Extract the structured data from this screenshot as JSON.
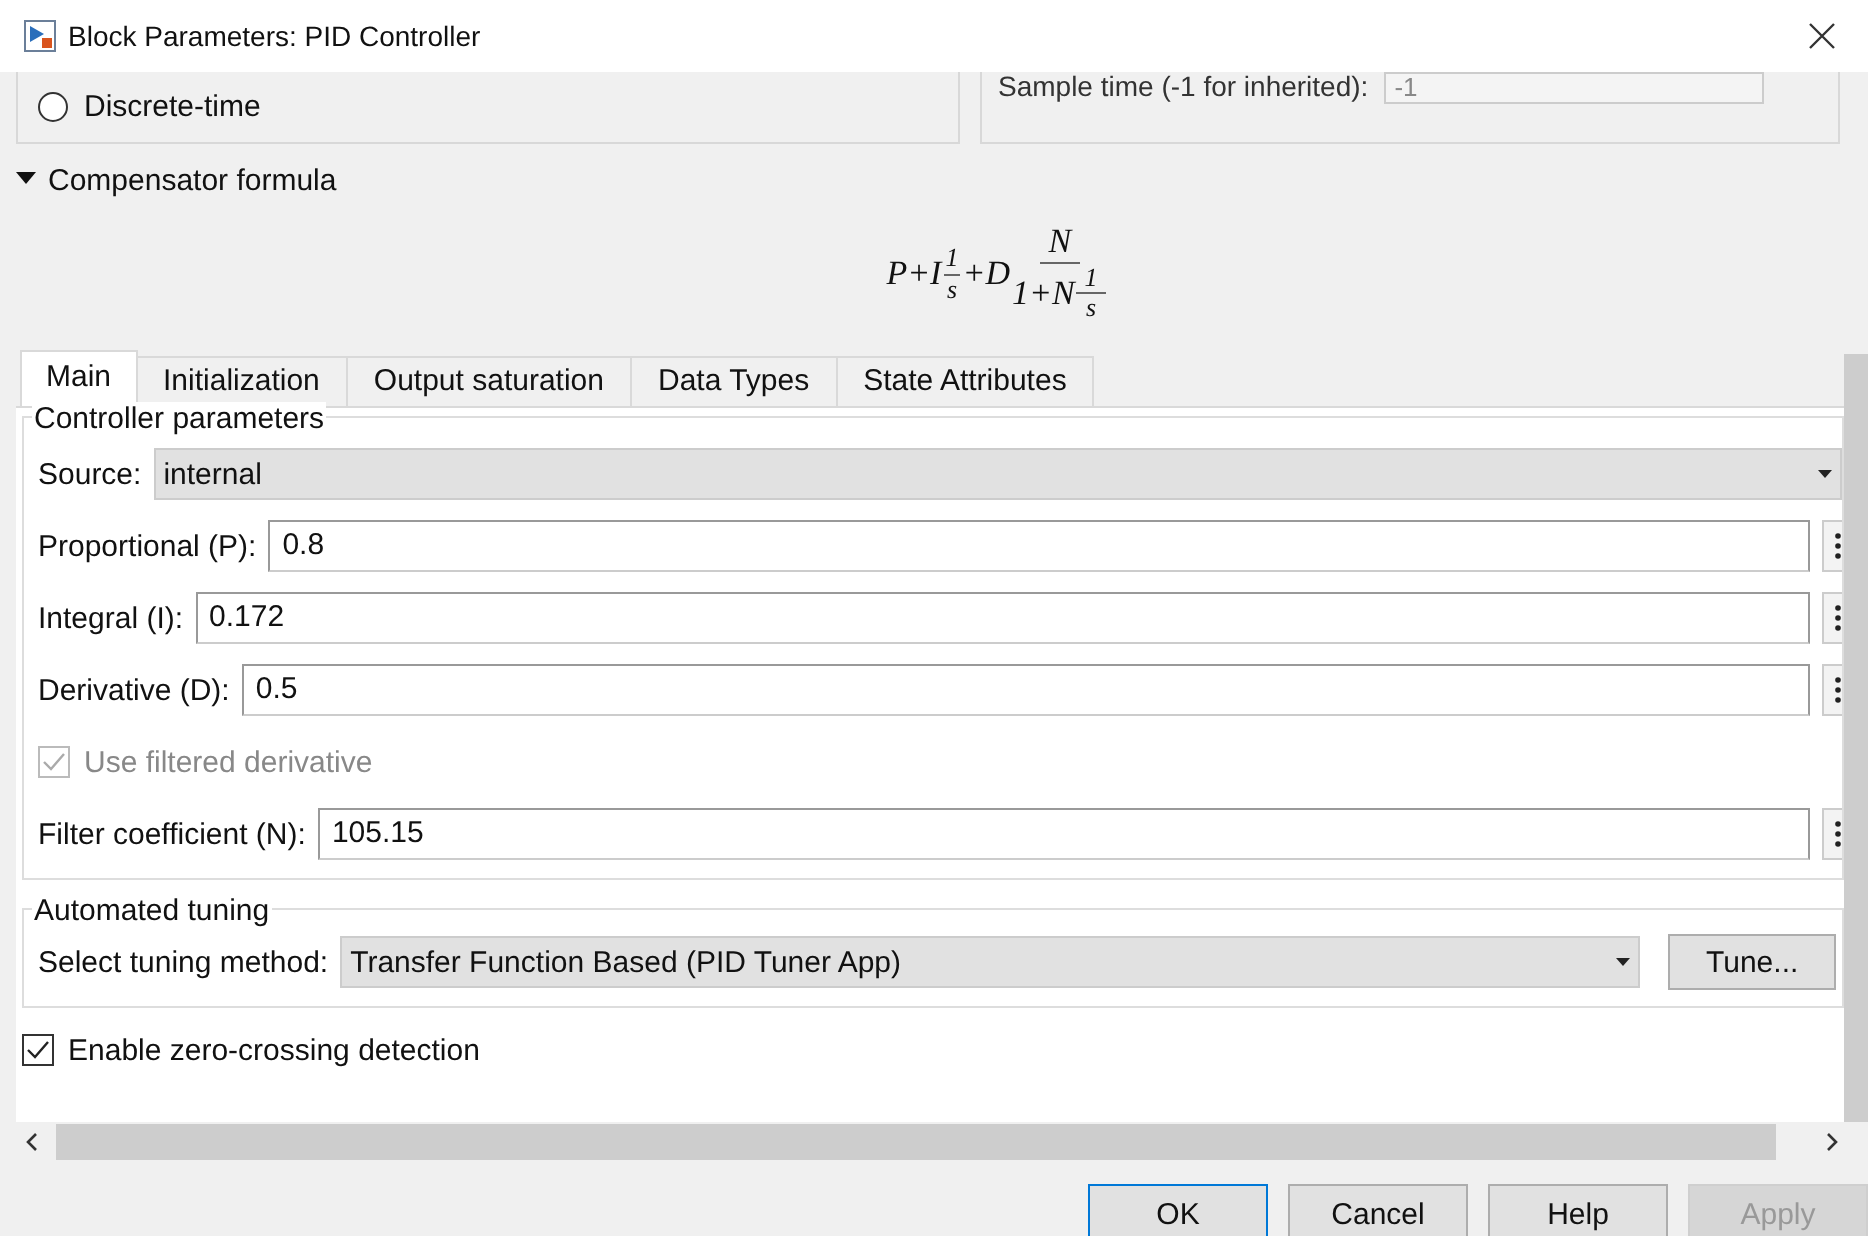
{
  "window": {
    "title": "Block Parameters: PID Controller"
  },
  "top_partial": {
    "radio": {
      "label": "Discrete-time",
      "selected": false
    },
    "sample_time": {
      "label": "Sample time (-1 for inherited):",
      "value": "-1",
      "disabled": true
    }
  },
  "compensator": {
    "label": "Compensator formula",
    "expanded": true,
    "formula": {
      "lead": "P+I",
      "frac1": {
        "num": "1",
        "den": "s"
      },
      "mid": "+D",
      "frac2": {
        "num": "N",
        "den_lead": "1+N",
        "den_frac": {
          "num": "1",
          "den": "s"
        }
      }
    }
  },
  "tabs": [
    {
      "label": "Main",
      "selected": true
    },
    {
      "label": "Initialization",
      "selected": false
    },
    {
      "label": "Output saturation",
      "selected": false
    },
    {
      "label": "Data Types",
      "selected": false
    },
    {
      "label": "State Attributes",
      "selected": false
    }
  ],
  "controller_parameters": {
    "title": "Controller parameters",
    "rows": [
      {
        "kind": "dropdown",
        "label": "Source:",
        "value": "internal"
      },
      {
        "kind": "field",
        "label": "Proportional (P):",
        "value": "0.8"
      },
      {
        "kind": "field",
        "label": "Integral (I):",
        "value": "0.172"
      },
      {
        "kind": "field",
        "label": "Derivative (D):",
        "value": "0.5"
      },
      {
        "kind": "checkbox",
        "label": "Use filtered derivative",
        "checked": true,
        "disabled": true
      },
      {
        "kind": "field",
        "label": "Filter coefficient (N):",
        "value": "105.15"
      }
    ]
  },
  "automated_tuning": {
    "title": "Automated tuning",
    "label": "Select tuning method:",
    "value": "Transfer Function Based (PID Tuner App)",
    "button": "Tune..."
  },
  "zero_crossing": {
    "label": "Enable zero-crossing detection",
    "checked": true
  },
  "buttons": [
    {
      "label": "OK",
      "focused": true,
      "disabled": false
    },
    {
      "label": "Cancel",
      "focused": false,
      "disabled": false
    },
    {
      "label": "Help",
      "focused": false,
      "disabled": false
    },
    {
      "label": "Apply",
      "focused": false,
      "disabled": true
    }
  ]
}
